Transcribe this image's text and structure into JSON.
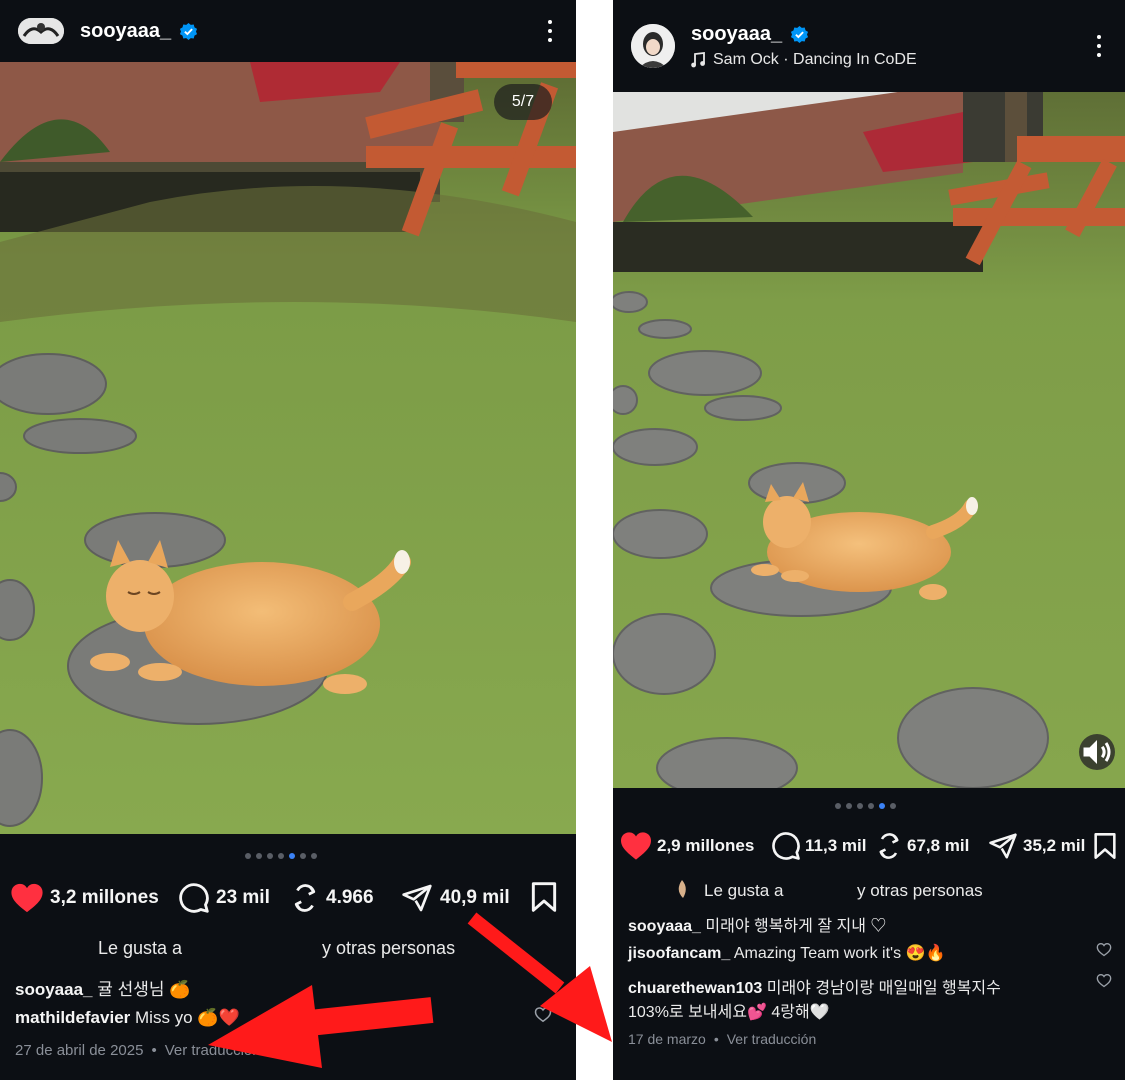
{
  "left_post": {
    "username": "sooyaaa_",
    "slide_counter": "5/7",
    "carousel": {
      "total": 7,
      "active": 5
    },
    "actions": {
      "likes": "3,2 millones",
      "comments": "23 mil",
      "reposts": "4.966",
      "shares": "40,9 mil"
    },
    "liked_by_prefix": "Le gusta a",
    "liked_by_suffix": "y otras personas",
    "caption": {
      "user": "sooyaaa_",
      "text": "귤 선생님 🍊"
    },
    "comment": {
      "user": "mathildefavier",
      "text": "Miss yo",
      "emoji": "🍊❤️"
    },
    "date": "27 de abril de 2025",
    "translate": "Ver traducción"
  },
  "right_post": {
    "username": "sooyaaa_",
    "music": "Sam Ock · Dancing In CoDE",
    "carousel": {
      "total": 6,
      "active": 5
    },
    "actions": {
      "likes": "2,9 millones",
      "comments": "11,3 mil",
      "reposts": "67,8 mil",
      "shares": "35,2 mil"
    },
    "liked_by_prefix": "Le gusta a",
    "liked_by_suffix": "y otras personas",
    "caption": {
      "user": "sooyaaa_",
      "text": "미래야 행복하게 잘 지내 ♡"
    },
    "comments": [
      {
        "user": "jisoofancam_",
        "text": "Amazing Team work it's 😍🔥"
      },
      {
        "user": "chuarethewan103",
        "text": "미래야 경남이랑 매일매일 행복지수"
      },
      {
        "user": "",
        "text": "103%로 보내세요💕 4랑해🤍"
      }
    ],
    "date": "17 de marzo",
    "translate": "Ver traducción"
  },
  "colors": {
    "background": "#0c0f14",
    "like_red": "#ff3040",
    "verified_blue": "#0095f6",
    "annotation_arrow": "#ff1a1a",
    "grass": "#7ea04a",
    "cat": "#e9a75c"
  },
  "icons": [
    "heart-icon",
    "comment-icon",
    "repost-icon",
    "share-icon",
    "bookmark-icon",
    "verified-icon",
    "music-note-icon",
    "more-icon",
    "sound-icon"
  ]
}
